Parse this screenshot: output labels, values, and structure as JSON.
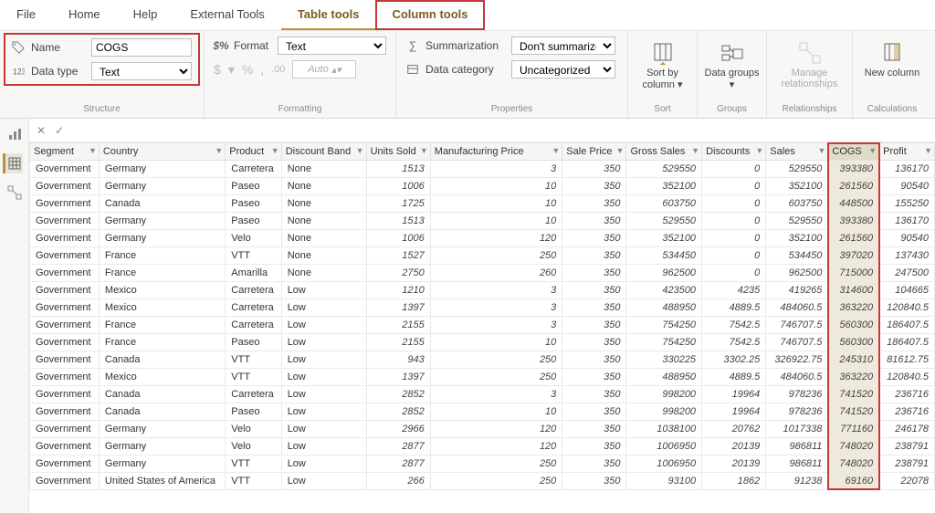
{
  "tabs": [
    "File",
    "Home",
    "Help",
    "External Tools",
    "Table tools",
    "Column tools"
  ],
  "ribbon": {
    "structure": {
      "name_lbl": "Name",
      "name_val": "COGS",
      "type_lbl": "Data type",
      "type_val": "Text",
      "label": "Structure"
    },
    "formatting": {
      "format_lbl": "Format",
      "format_val": "Text",
      "sym": {
        "dollar": "$",
        "pct": "%",
        "comma": ",",
        "dec": ".00"
      },
      "auto": "Auto",
      "label": "Formatting"
    },
    "properties": {
      "sum_lbl": "Summarization",
      "sum_val": "Don't summarize",
      "cat_lbl": "Data category",
      "cat_val": "Uncategorized",
      "label": "Properties"
    },
    "sort": {
      "btn": "Sort by column",
      "drop": "▾",
      "label": "Sort"
    },
    "groups": {
      "btn": "Data groups",
      "drop": "▾",
      "label": "Groups"
    },
    "rel": {
      "btn": "Manage relationships",
      "label": "Relationships"
    },
    "calc": {
      "btn": "New column",
      "label": "Calculations"
    }
  },
  "columns": [
    "Segment",
    "Country",
    "Product",
    "Discount Band",
    "Units Sold",
    "Manufacturing Price",
    "Sale Price",
    "Gross Sales",
    "Discounts",
    "Sales",
    "COGS",
    "Profit"
  ],
  "selected_column": "COGS",
  "rows": [
    [
      "Government",
      "Germany",
      "Carretera",
      "None",
      "1513",
      "3",
      "350",
      "529550",
      "0",
      "529550",
      "393380",
      "136170"
    ],
    [
      "Government",
      "Germany",
      "Paseo",
      "None",
      "1006",
      "10",
      "350",
      "352100",
      "0",
      "352100",
      "261560",
      "90540"
    ],
    [
      "Government",
      "Canada",
      "Paseo",
      "None",
      "1725",
      "10",
      "350",
      "603750",
      "0",
      "603750",
      "448500",
      "155250"
    ],
    [
      "Government",
      "Germany",
      "Paseo",
      "None",
      "1513",
      "10",
      "350",
      "529550",
      "0",
      "529550",
      "393380",
      "136170"
    ],
    [
      "Government",
      "Germany",
      "Velo",
      "None",
      "1006",
      "120",
      "350",
      "352100",
      "0",
      "352100",
      "261560",
      "90540"
    ],
    [
      "Government",
      "France",
      "VTT",
      "None",
      "1527",
      "250",
      "350",
      "534450",
      "0",
      "534450",
      "397020",
      "137430"
    ],
    [
      "Government",
      "France",
      "Amarilla",
      "None",
      "2750",
      "260",
      "350",
      "962500",
      "0",
      "962500",
      "715000",
      "247500"
    ],
    [
      "Government",
      "Mexico",
      "Carretera",
      "Low",
      "1210",
      "3",
      "350",
      "423500",
      "4235",
      "419265",
      "314600",
      "104665"
    ],
    [
      "Government",
      "Mexico",
      "Carretera",
      "Low",
      "1397",
      "3",
      "350",
      "488950",
      "4889.5",
      "484060.5",
      "363220",
      "120840.5"
    ],
    [
      "Government",
      "France",
      "Carretera",
      "Low",
      "2155",
      "3",
      "350",
      "754250",
      "7542.5",
      "746707.5",
      "560300",
      "186407.5"
    ],
    [
      "Government",
      "France",
      "Paseo",
      "Low",
      "2155",
      "10",
      "350",
      "754250",
      "7542.5",
      "746707.5",
      "560300",
      "186407.5"
    ],
    [
      "Government",
      "Canada",
      "VTT",
      "Low",
      "943",
      "250",
      "350",
      "330225",
      "3302.25",
      "326922.75",
      "245310",
      "81612.75"
    ],
    [
      "Government",
      "Mexico",
      "VTT",
      "Low",
      "1397",
      "250",
      "350",
      "488950",
      "4889.5",
      "484060.5",
      "363220",
      "120840.5"
    ],
    [
      "Government",
      "Canada",
      "Carretera",
      "Low",
      "2852",
      "3",
      "350",
      "998200",
      "19964",
      "978236",
      "741520",
      "236716"
    ],
    [
      "Government",
      "Canada",
      "Paseo",
      "Low",
      "2852",
      "10",
      "350",
      "998200",
      "19964",
      "978236",
      "741520",
      "236716"
    ],
    [
      "Government",
      "Germany",
      "Velo",
      "Low",
      "2966",
      "120",
      "350",
      "1038100",
      "20762",
      "1017338",
      "771160",
      "246178"
    ],
    [
      "Government",
      "Germany",
      "Velo",
      "Low",
      "2877",
      "120",
      "350",
      "1006950",
      "20139",
      "986811",
      "748020",
      "238791"
    ],
    [
      "Government",
      "Germany",
      "VTT",
      "Low",
      "2877",
      "250",
      "350",
      "1006950",
      "20139",
      "986811",
      "748020",
      "238791"
    ],
    [
      "Government",
      "United States of America",
      "VTT",
      "Low",
      "266",
      "250",
      "350",
      "93100",
      "1862",
      "91238",
      "69160",
      "22078"
    ]
  ]
}
